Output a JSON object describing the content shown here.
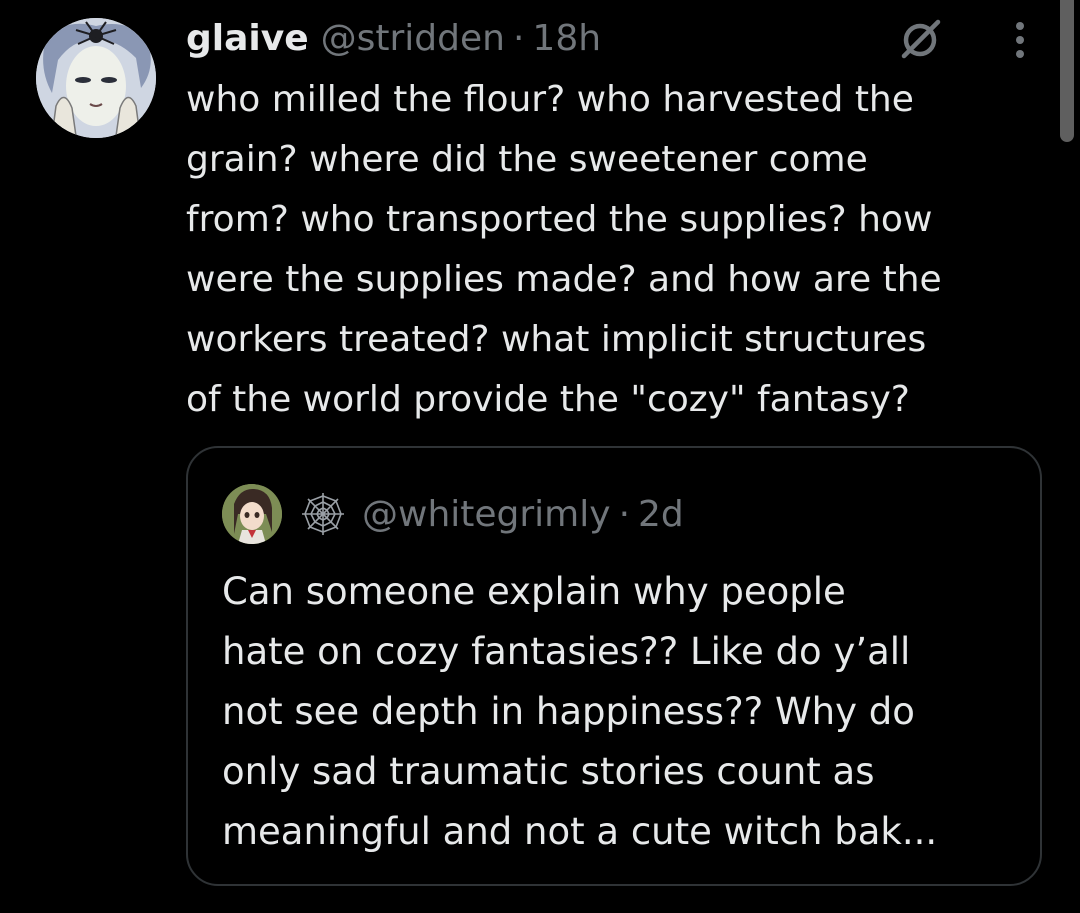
{
  "tweet": {
    "author": {
      "display_name": "glaive",
      "handle": "@stridden",
      "separator": "·",
      "time": "18h",
      "avatar_icon": "drawn-face-avatar"
    },
    "text_lines": [
      "who milled the flour? who harvested the",
      "grain? where did the sweetener come",
      "from? who transported the supplies? how",
      "were the supplies made? and how are the",
      "workers treated? what implicit structures",
      "of the world provide the \"cozy\" fantasy?"
    ],
    "icons": {
      "grok": "grok-icon",
      "more": "more-options-icon"
    }
  },
  "quote": {
    "handle": "@whitegrimly",
    "separator": "·",
    "time": "2d",
    "avatar_icon": "anime-character-avatar",
    "name_emoji_icon": "spider-web-icon",
    "text_lines": [
      "Can someone explain why people",
      "hate on cozy fantasies?? Like do y’all",
      "not see depth in happiness?? Why do",
      "only sad traumatic stories count as",
      "meaningful and not a cute witch bak..."
    ]
  },
  "colors": {
    "background": "#000000",
    "text_primary": "#e7e9ea",
    "text_secondary": "#71767b",
    "card_border": "#2f3336"
  }
}
